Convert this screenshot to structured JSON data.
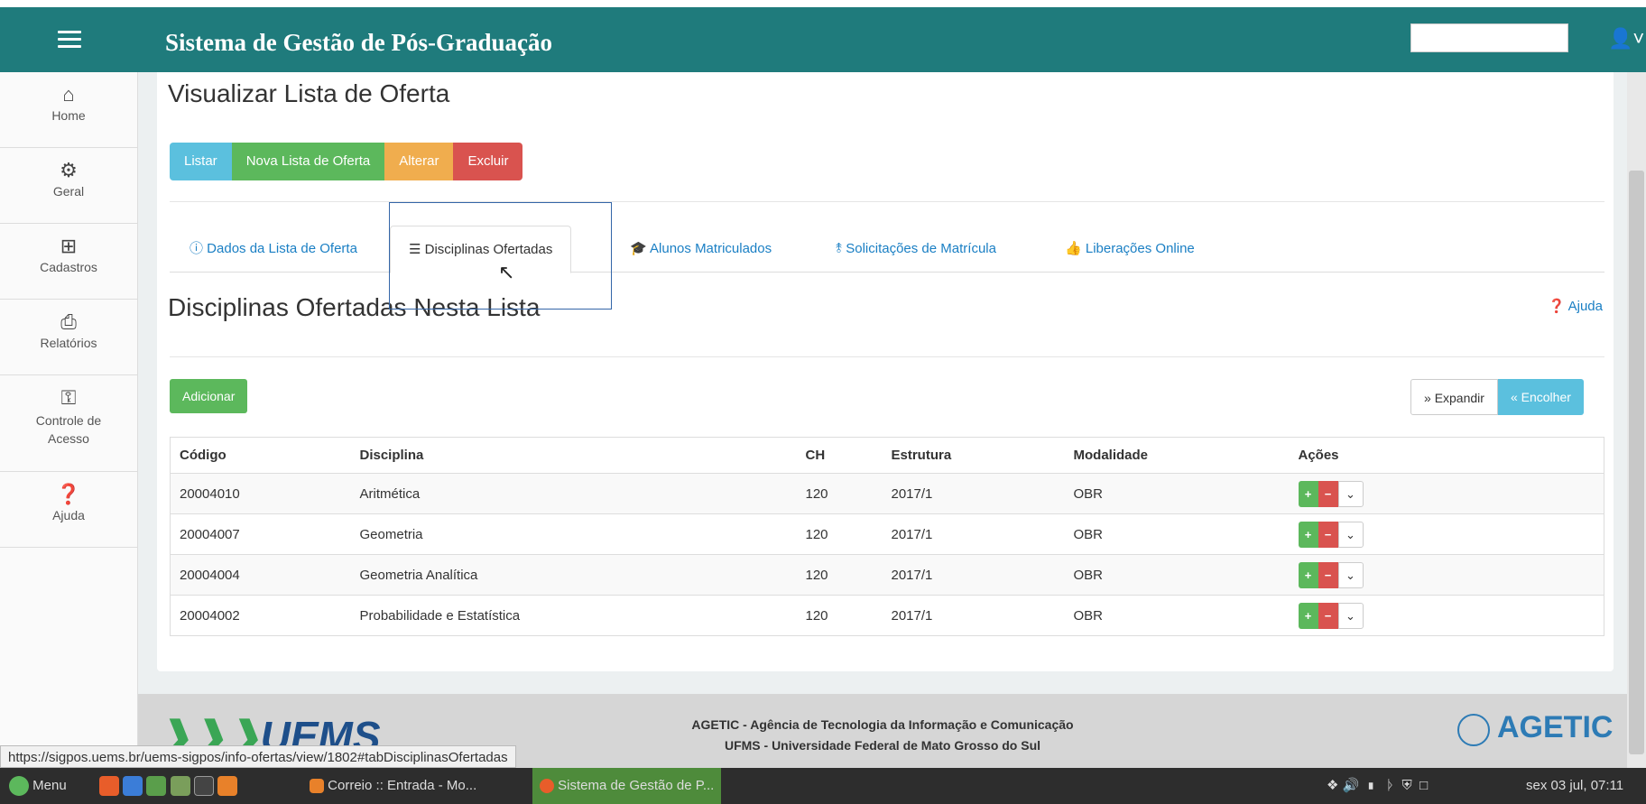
{
  "header": {
    "title": "Sistema de Gestão de Pós-Graduação",
    "menu_icon": "hamburger-icon",
    "user_icon": "user-icon",
    "search_value": ""
  },
  "sidebar": {
    "items": [
      {
        "label": "Home",
        "icon": "home-icon"
      },
      {
        "label": "Geral",
        "icon": "cogs-icon"
      },
      {
        "label": "Cadastros",
        "icon": "plus-square-icon"
      },
      {
        "label": "Relatórios",
        "icon": "print-icon"
      },
      {
        "label": "Controle de Acesso",
        "icon": "key-icon"
      },
      {
        "label": "Ajuda",
        "icon": "question-icon"
      }
    ]
  },
  "page": {
    "title": "Visualizar Lista de Oferta"
  },
  "actions": {
    "listar": "Listar",
    "nova": "Nova Lista de Oferta",
    "alterar": "Alterar",
    "excluir": "Excluir"
  },
  "tabs": [
    {
      "label": "Dados da Lista de Oferta",
      "icon": "info-icon"
    },
    {
      "label": "Disciplinas Ofertadas",
      "icon": "list-icon",
      "active": true
    },
    {
      "label": "Alunos Matriculados",
      "icon": "graduation-cap-icon"
    },
    {
      "label": "Solicitações de Matrícula",
      "icon": "signal-icon"
    },
    {
      "label": "Liberações Online",
      "icon": "thumbs-up-icon"
    }
  ],
  "section": {
    "title": "Disciplinas Ofertadas Nesta Lista",
    "help": "Ajuda",
    "add": "Adicionar",
    "expand": "Expandir",
    "collapse": "Encolher"
  },
  "table": {
    "headers": [
      "Código",
      "Disciplina",
      "CH",
      "Estrutura",
      "Modalidade",
      "Ações"
    ],
    "rows": [
      [
        "20004010",
        "Aritmética",
        "120",
        "2017/1",
        "OBR"
      ],
      [
        "20004007",
        "Geometria",
        "120",
        "2017/1",
        "OBR"
      ],
      [
        "20004004",
        "Geometria Analítica",
        "120",
        "2017/1",
        "OBR"
      ],
      [
        "20004002",
        "Probabilidade e Estatística",
        "120",
        "2017/1",
        "OBR"
      ]
    ]
  },
  "footer": {
    "logo_left": "UEMS",
    "line1": "AGETIC - Agência de Tecnologia da Informação e Comunicação",
    "line2": "UFMS - Universidade Federal de Mato Grosso do Sul",
    "logo_right": "AGETIC"
  },
  "statusbar": {
    "url": "https://sigpos.uems.br/uems-sigpos/info-ofertas/view/1802#tabDisciplinasOfertadas"
  },
  "taskbar": {
    "menu": "Menu",
    "win1": "Correio :: Entrada - Mo...",
    "win2": "Sistema de Gestão de P...",
    "clock": "sex 03 jul, 07:11"
  },
  "colors": {
    "header": "#1f7b7c",
    "info": "#5bc0de",
    "success": "#5cb85c",
    "warning": "#f0ad4e",
    "danger": "#d9534f",
    "link": "#1a7fc4"
  }
}
